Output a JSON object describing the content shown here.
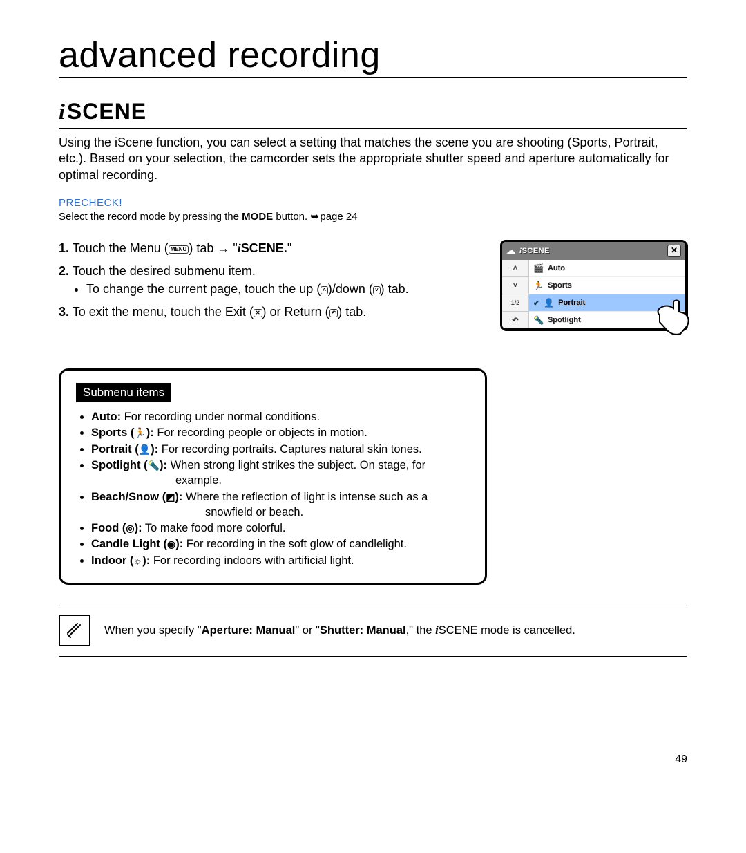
{
  "chapter_title": "advanced recording",
  "section": {
    "prefix": "i",
    "title": "SCENE"
  },
  "intro": "Using the iScene function, you can select a setting that matches the scene you are shooting (Sports, Portrait, etc.). Based on your selection, the camcorder sets the appropriate shutter speed and aperture automatically for optimal recording.",
  "precheck": {
    "label": "PRECHECK!",
    "pre": "Select the record mode by pressing the ",
    "bold": "MODE",
    "post": " button. ",
    "page_ref": "page 24"
  },
  "steps": {
    "s1_pre": "Touch the Menu (",
    "s1_icon": "MENU",
    "s1_mid": ") tab ",
    "s1_arrow": "→",
    "s1_quote_open": " \"",
    "s1_bold_prefix": "i",
    "s1_bold": "SCENE.",
    "s1_quote_close": "\"",
    "s2": "Touch the desired submenu item.",
    "s2_sub_pre": "To change the current page, touch the up (",
    "s2_sub_mid": ")/down (",
    "s2_sub_post": ") tab.",
    "s3_pre": "To exit the menu, touch the Exit (",
    "s3_mid": ") or Return (",
    "s3_post": ") tab."
  },
  "screen": {
    "title_prefix": "i",
    "title": "SCENE",
    "close": "✕",
    "nav_up": "˄",
    "nav_down": "˅",
    "nav_page": "1/2",
    "nav_return": "↶",
    "rows": {
      "auto": "Auto",
      "sports": "Sports",
      "portrait": "Portrait",
      "spotlight": "Spotlight"
    }
  },
  "submenu": {
    "heading": "Submenu items",
    "items": {
      "auto": {
        "name": "Auto:",
        "desc": " For recording under normal conditions."
      },
      "sports": {
        "name": "Sports (",
        "suffix": "):",
        "desc": " For recording people or objects in motion."
      },
      "portrait": {
        "name": "Portrait (",
        "suffix": "):",
        "desc": " For recording portraits. Captures natural skin tones."
      },
      "spotlight": {
        "name": "Spotlight (",
        "suffix": "):",
        "desc": " When strong light strikes the subject. On stage, for",
        "desc2": "example."
      },
      "beach": {
        "name": "Beach/Snow (",
        "suffix": "):",
        "desc": " Where the reflection of light is intense such as a",
        "desc2": "snowfield or beach."
      },
      "food": {
        "name": "Food (",
        "suffix": "):",
        "desc": " To make food more colorful."
      },
      "candle": {
        "name": "Candle Light (",
        "suffix": "):",
        "desc": " For recording in the soft glow of candlelight."
      },
      "indoor": {
        "name": "Indoor (",
        "suffix": "):",
        "desc": " For recording indoors with artificial light."
      }
    }
  },
  "note": {
    "pre": "When you specify \"",
    "bold1": "Aperture: Manual",
    "mid": "\" or \"",
    "bold2": "Shutter: Manual",
    "post1": ",\" the ",
    "scene_prefix": "i",
    "post2": "SCENE mode is cancelled."
  },
  "page_number": "49"
}
